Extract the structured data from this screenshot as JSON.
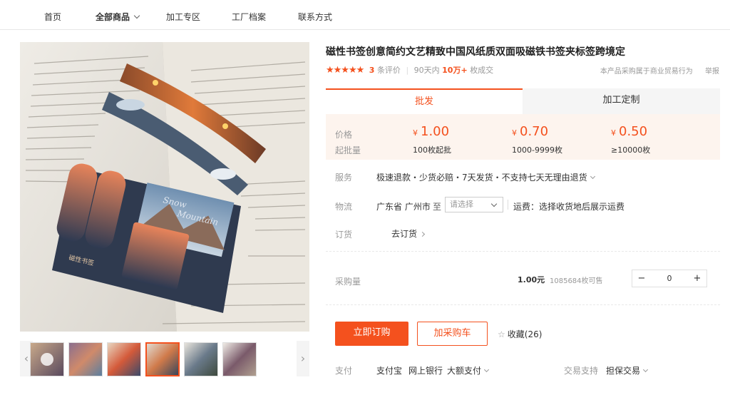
{
  "nav": {
    "items": [
      "首页",
      "全部商品",
      "加工专区",
      "工厂档案",
      "联系方式"
    ]
  },
  "product": {
    "title": "磁性书签创意简约文艺精致中国风纸质双面吸磁铁书签夹标签跨境定",
    "stars": "★★★★★",
    "review_count": "3",
    "review_label": "条评价",
    "sales_prefix": "90天内",
    "sales_count": "10万+",
    "sales_suffix": "枚成交",
    "notice": "本产品采购属于商业贸易行为",
    "report": "举报"
  },
  "tabs": [
    "批发",
    "加工定制"
  ],
  "pricing": {
    "price_label": "价格",
    "moq_label": "起批量",
    "currency": "¥",
    "tiers": [
      {
        "price": "1.00",
        "range": "100枚起批"
      },
      {
        "price": "0.70",
        "range": "1000-9999枚"
      },
      {
        "price": "0.50",
        "range": "≥10000枚"
      }
    ]
  },
  "service": {
    "label": "服务",
    "value": "极速退款・少货必赔・7天发货・不支持七天无理由退货"
  },
  "logistics": {
    "label": "物流",
    "origin": "广东省 广州市",
    "to": "至",
    "select_placeholder": "请选择",
    "freight": "运费：选择收货地后展示运费"
  },
  "order": {
    "label": "订货",
    "link": "去订货"
  },
  "purchase": {
    "label": "采购量",
    "unit_price": "1.00元",
    "stock": "1085684枚可售",
    "minus": "−",
    "quantity": "0",
    "plus": "+"
  },
  "actions": {
    "buy_now": "立即订购",
    "add_cart": "加采购车",
    "favorite": "收藏(26)"
  },
  "payment": {
    "label": "支付",
    "methods": [
      "支付宝",
      "网上银行",
      "大额支付"
    ],
    "support_label": "交易支持",
    "support_value": "担保交易"
  },
  "gallery": {
    "card_text_1": "Snow",
    "card_text_2": "Mountain",
    "pack_text": "磁性书签",
    "prev": "‹",
    "next": "›"
  },
  "colors": {
    "accent": "#f4511e",
    "price_bg": "#fdf4ee"
  }
}
